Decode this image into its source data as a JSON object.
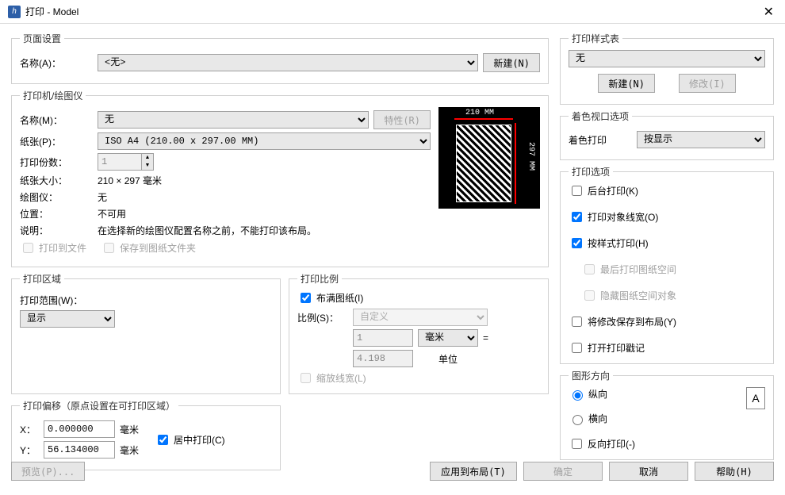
{
  "window": {
    "title": "打印 - Model"
  },
  "page_setup": {
    "legend": "页面设置",
    "name_label": "名称(A)：",
    "name_value": "<无>",
    "new_btn": "新建(N)"
  },
  "printer": {
    "legend": "打印机/绘图仪",
    "name_label": "名称(M)：",
    "name_value": "无",
    "props_btn": "特性(R)",
    "paper_label": "纸张(P)：",
    "paper_value": "ISO A4 (210.00 x 297.00 MM)",
    "copies_label": "打印份数：",
    "copies_value": "1",
    "size_label": "纸张大小：",
    "size_value": "210 × 297  毫米",
    "plotter_label": "绘图仪：",
    "plotter_value": "无",
    "location_label": "位置：",
    "location_value": "不可用",
    "desc_label": "说明：",
    "desc_value": "在选择新的绘图仪配置名称之前，不能打印该布局。",
    "to_file": "打印到文件",
    "save_sheet": "保存到图纸文件夹",
    "preview": {
      "dim_w": "210 MM",
      "dim_h": "297 MM"
    }
  },
  "area": {
    "legend": "打印区域",
    "range_label": "打印范围(W)：",
    "range_value": "显示"
  },
  "scale": {
    "legend": "打印比例",
    "fit": "布满图纸(I)",
    "ratio_label": "比例(S)：",
    "ratio_value": "自定义",
    "num": "1",
    "unit_sel": "毫米",
    "eq": "=",
    "den": "4.198",
    "unit_text": "单位",
    "scale_lw": "缩放线宽(L)"
  },
  "offset": {
    "legend": "打印偏移（原点设置在可打印区域）",
    "x_label": "X：",
    "x_value": "0.000000",
    "y_label": "Y：",
    "y_value": "56.134000",
    "mm": "毫米",
    "center": "居中打印(C)"
  },
  "style_table": {
    "legend": "打印样式表",
    "value": "无",
    "new_btn": "新建(N)",
    "edit_btn": "修改(I)"
  },
  "shaded": {
    "legend": "着色视口选项",
    "label": "着色打印",
    "value": "按显示"
  },
  "options": {
    "legend": "打印选项",
    "background": "后台打印(K)",
    "obj_lw": "打印对象线宽(O)",
    "by_style": "按样式打印(H)",
    "paperspace_last": "最后打印图纸空间",
    "hide_ps": "隐藏图纸空间对象",
    "save_layout": "将修改保存到布局(Y)",
    "stamp": "打开打印戳记"
  },
  "orientation": {
    "legend": "图形方向",
    "portrait": "纵向",
    "landscape": "横向",
    "upside": "反向打印(-)"
  },
  "buttons": {
    "preview": "预览(P)...",
    "apply": "应用到布局(T)",
    "ok": "确定",
    "cancel": "取消",
    "help": "帮助(H)"
  }
}
